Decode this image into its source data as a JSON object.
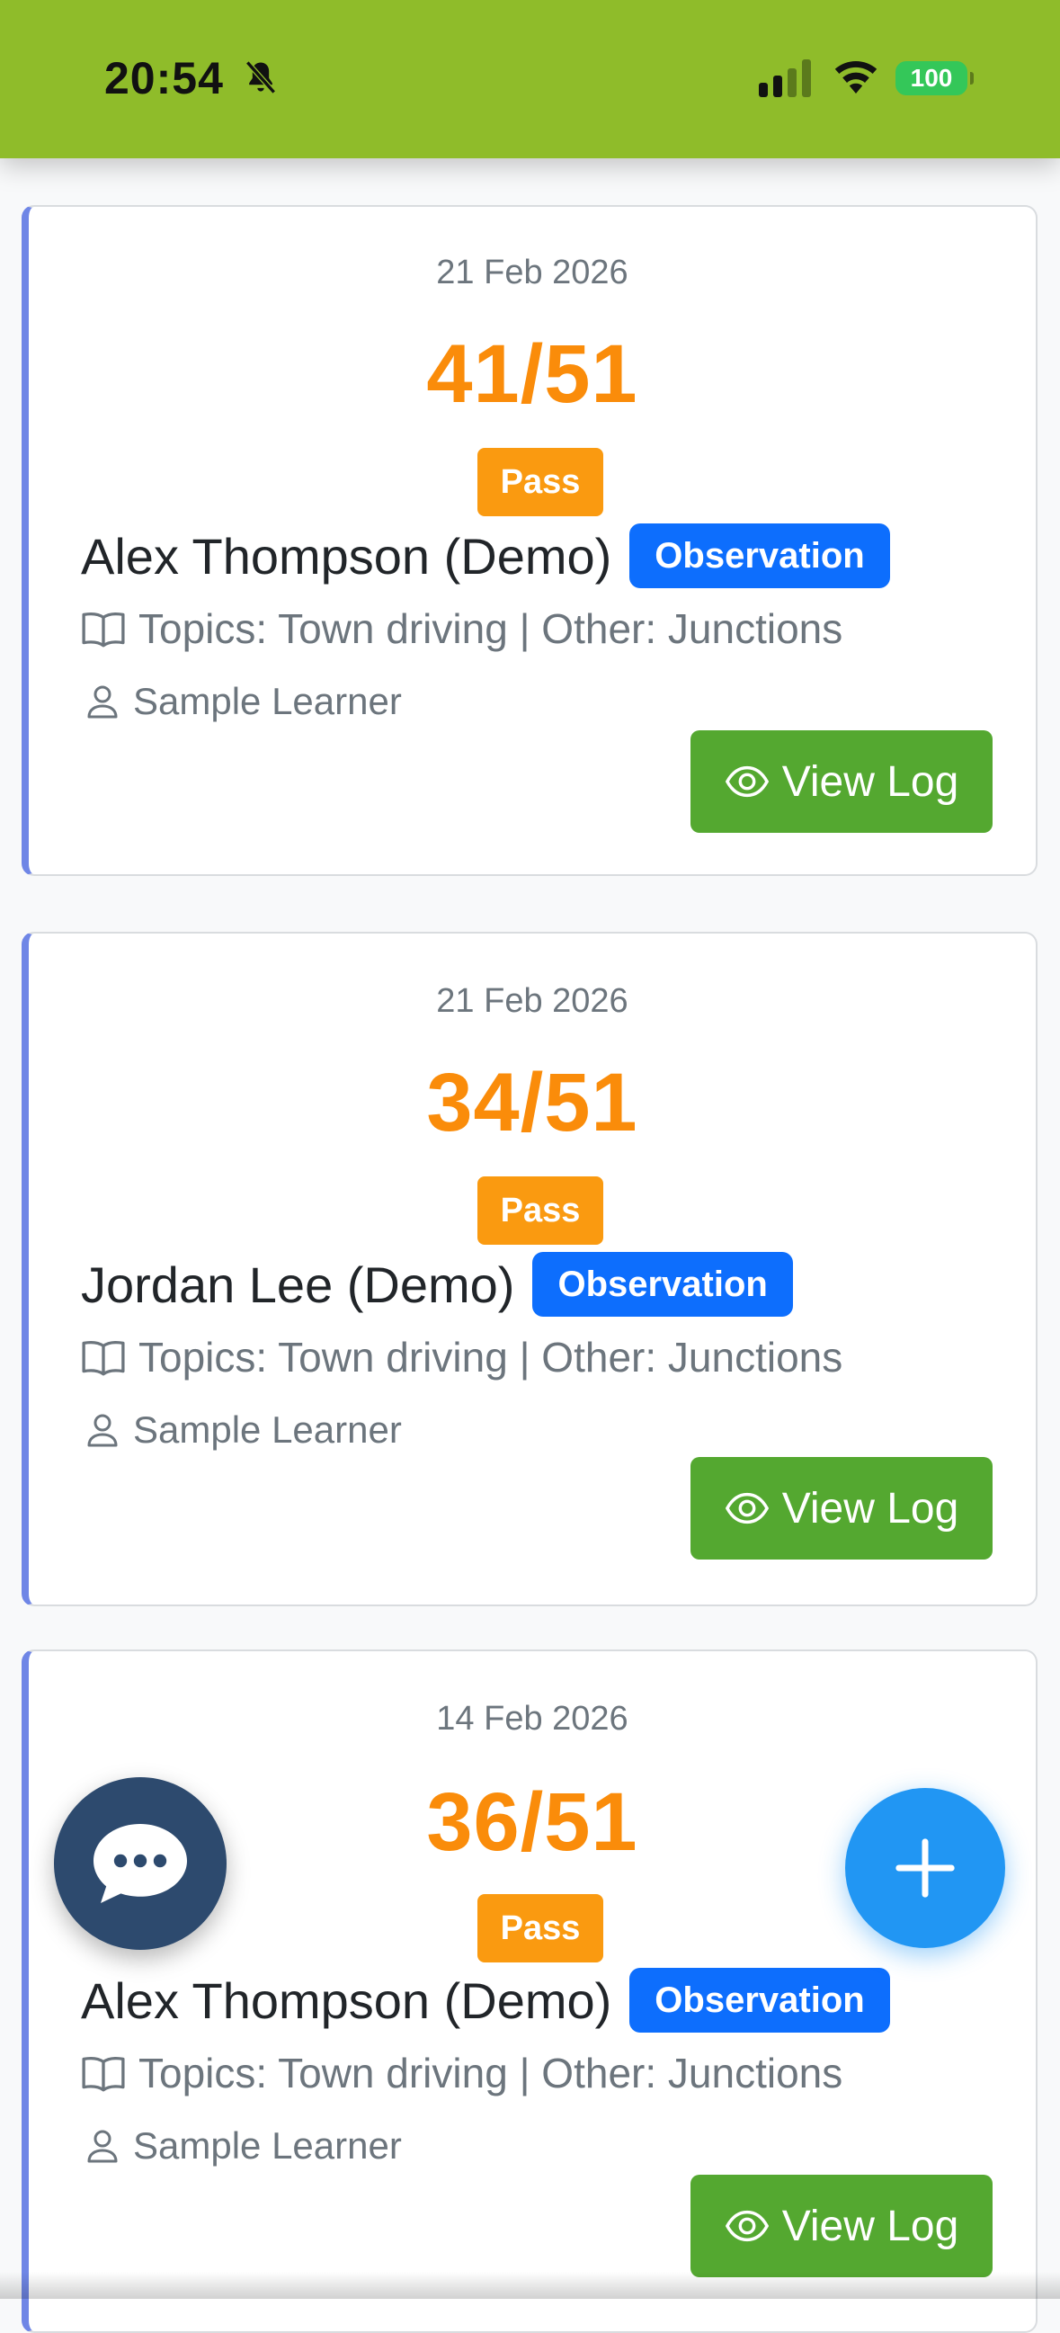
{
  "status_bar": {
    "time": "20:54",
    "battery": "100",
    "icons": [
      "bell-slash-icon",
      "signal-icon",
      "wifi-icon",
      "battery-icon"
    ]
  },
  "cards": [
    {
      "date": "21 Feb 2026",
      "score": "41/51",
      "result": "Pass",
      "learner": "Alex Thompson (Demo)",
      "type": "Observation",
      "topics": "Topics: Town driving | Other: Junctions",
      "person": "Sample Learner",
      "view_label": "View Log"
    },
    {
      "date": "21 Feb 2026",
      "score": "34/51",
      "result": "Pass",
      "learner": "Jordan Lee (Demo)",
      "type": "Observation",
      "topics": "Topics: Town driving | Other: Junctions",
      "person": "Sample Learner",
      "view_label": "View Log"
    },
    {
      "date": "14 Feb 2026",
      "score": "36/51",
      "result": "Pass",
      "learner": "Alex Thompson (Demo)",
      "type": "Observation",
      "topics": "Topics: Town driving | Other: Junctions",
      "person": "Sample Learner",
      "view_label": "View Log"
    }
  ],
  "fabs": {
    "chat_icon": "chat-bubble-icon",
    "add_icon": "plus-icon"
  },
  "colors": {
    "status_bar_bg": "#8fbc2a",
    "score": "#fa8c0a",
    "pass_badge": "#fa9a10",
    "observation_badge": "#0d6efd",
    "view_button": "#54a830",
    "card_accent": "#6f86e6",
    "chat_fab": "#2d4a6e",
    "add_fab": "#2196f3"
  }
}
